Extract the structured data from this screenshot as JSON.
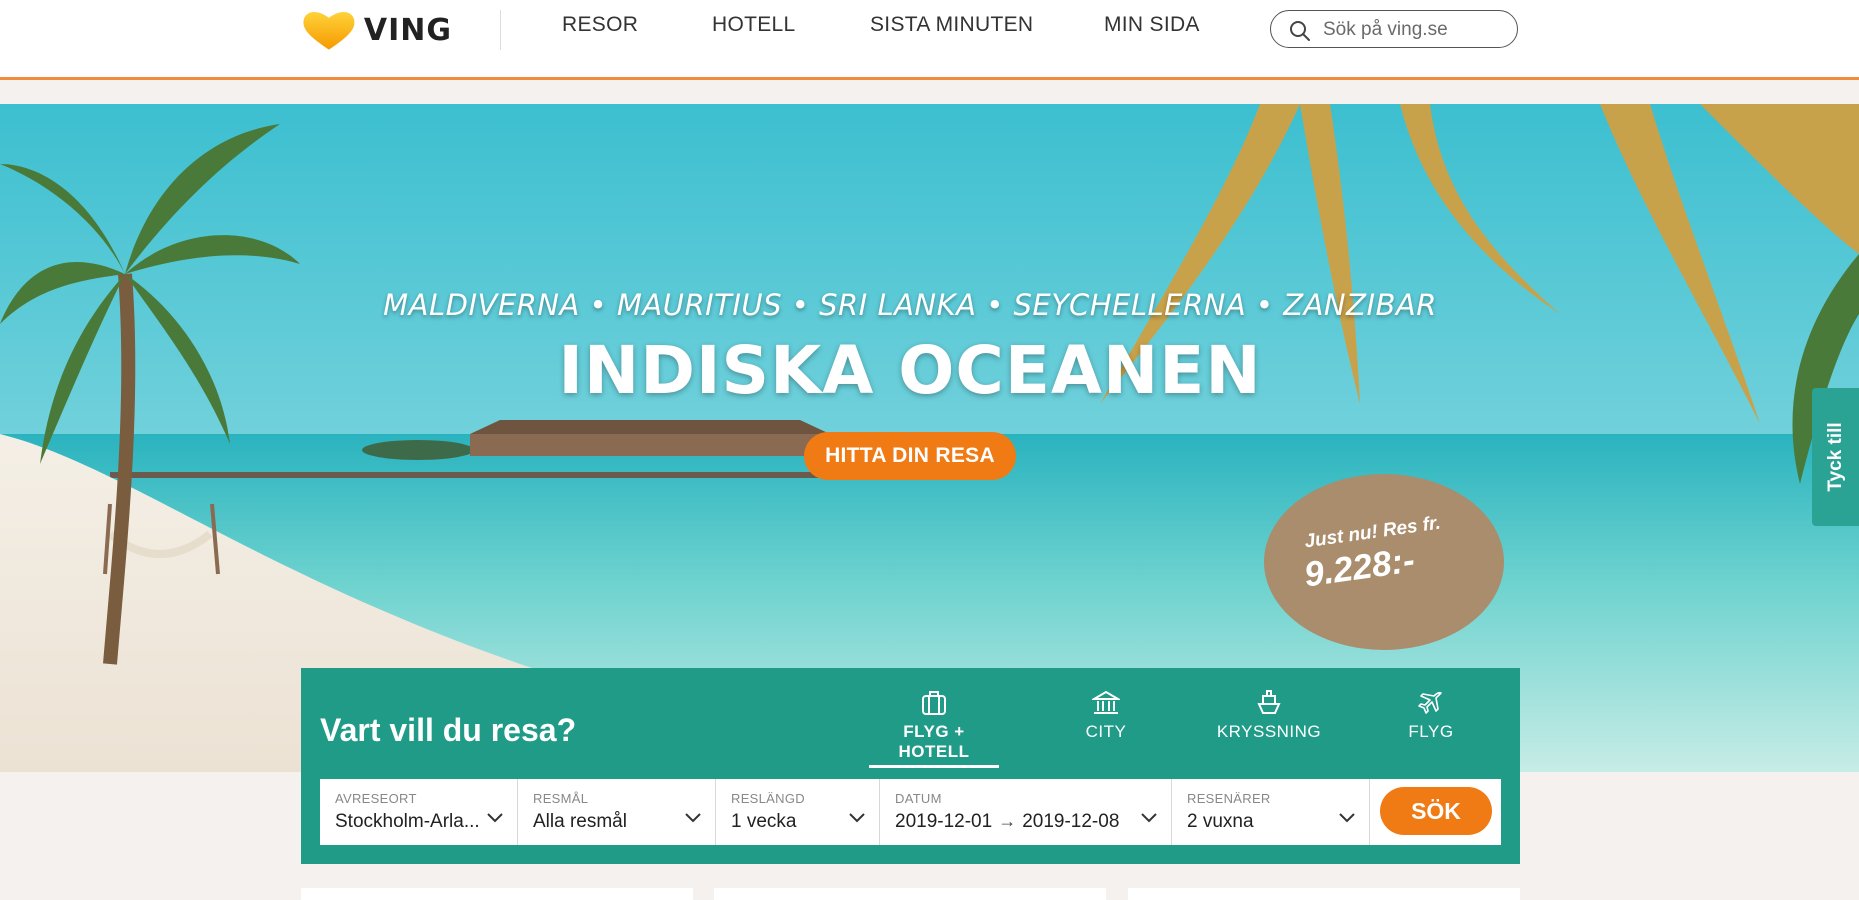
{
  "brand": {
    "name": "VING",
    "heart_color": "#f7b500"
  },
  "nav": [
    {
      "label": "RESOR"
    },
    {
      "label": "HOTELL"
    },
    {
      "label": "SISTA MINUTEN"
    },
    {
      "label": "MIN SIDA"
    }
  ],
  "search": {
    "placeholder": "Sök på ving.se",
    "icon": "search-icon"
  },
  "hero": {
    "subtitle": "MALDIVERNA • MAURITIUS • SRI LANKA • SEYCHELLERNA • ZANZIBAR",
    "title": "INDISKA OCEANEN",
    "cta": "HITTA DIN RESA",
    "price_label": "Just nu! Res fr.",
    "price_value": "9.228:-"
  },
  "feedback": {
    "label": "Tyck till"
  },
  "booking": {
    "title": "Vart vill du resa?",
    "tabs": [
      {
        "label": "FLYG + HOTELL",
        "icon": "suitcase-icon",
        "active": true
      },
      {
        "label": "CITY",
        "icon": "city-building-icon",
        "active": false
      },
      {
        "label": "KRYSSNING",
        "icon": "ship-icon",
        "active": false
      },
      {
        "label": "FLYG",
        "icon": "plane-icon",
        "active": false
      }
    ],
    "fields": {
      "departure": {
        "label": "AVRESEORT",
        "value": "Stockholm-Arla..."
      },
      "destination": {
        "label": "RESMÅL",
        "value": "Alla resmål"
      },
      "duration": {
        "label": "RESLÄNGD",
        "value": "1 vecka"
      },
      "date": {
        "label": "DATUM",
        "from": "2019-12-01",
        "to": "2019-12-08"
      },
      "travelers": {
        "label": "RESENÄRER",
        "value": "2 vuxna"
      }
    },
    "submit": "SÖK"
  },
  "colors": {
    "accent_orange": "#f07a14",
    "teal": "#1f9b87",
    "price_badge": "#a98d6c",
    "header_line": "#f08c3a"
  }
}
